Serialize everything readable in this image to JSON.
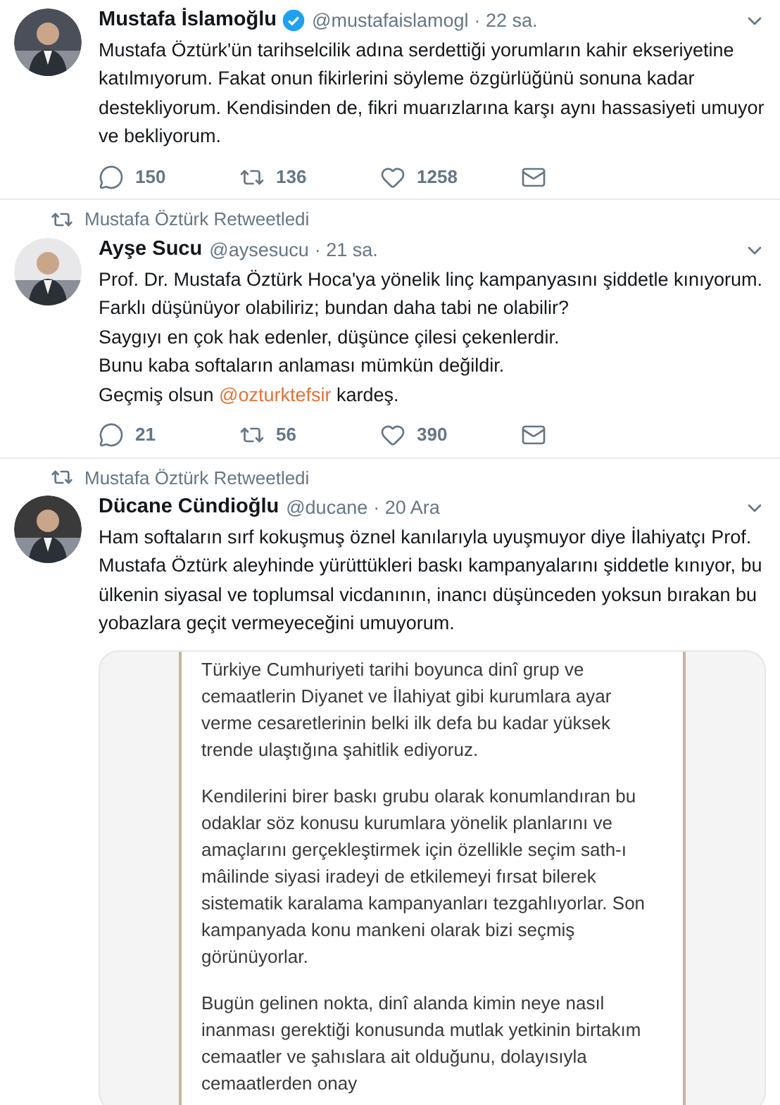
{
  "tweets": [
    {
      "name": "Mustafa İslamoğlu",
      "verified": true,
      "handle": "@mustafaislamogl",
      "time": "· 22 sa.",
      "body": [
        [
          {
            "text": "Mustafa Öztürk'ün tarihselcilik adına serdettiği yorumların kahir ekseriyetine katılmıyorum. Fakat onun fikirlerini söyleme özgürlüğünü sonuna kadar destekliyorum. Kendisinden de, fikri muarızlarına karşı aynı hassasiyeti umuyor ve bekliyorum.",
            "kind": "text"
          }
        ]
      ],
      "replies": "150",
      "retweets": "136",
      "likes": "1258"
    },
    {
      "retweeted_by": "Mustafa Öztürk Retweetledi",
      "name": "Ayşe Sucu",
      "verified": false,
      "handle": "@aysesucu",
      "time": "· 21 sa.",
      "body": [
        [
          {
            "text": "Prof. Dr. Mustafa Öztürk Hoca'ya yönelik linç kampanyasını şiddetle kınıyorum.",
            "kind": "text"
          }
        ],
        [
          {
            "text": "Farklı düşünüyor olabiliriz; bundan daha tabi ne olabilir?",
            "kind": "text"
          }
        ],
        [
          {
            "text": "Saygıyı en çok hak edenler, düşünce çilesi çekenlerdir.",
            "kind": "text"
          }
        ],
        [
          {
            "text": "Bunu kaba softaların anlaması mümkün değildir.",
            "kind": "text"
          }
        ],
        [
          {
            "text": "Geçmiş olsun ",
            "kind": "text"
          },
          {
            "text": "@ozturktefsir",
            "kind": "mention"
          },
          {
            "text": " kardeş.",
            "kind": "text"
          }
        ]
      ],
      "replies": "21",
      "retweets": "56",
      "likes": "390"
    },
    {
      "retweeted_by": "Mustafa Öztürk Retweetledi",
      "name": "Dücane Cündioğlu",
      "verified": false,
      "handle": "@ducane",
      "time": "· 20 Ara",
      "body": [
        [
          {
            "text": "Ham softaların sırf kokuşmuş öznel kanılarıyla uyuşmuyor diye İlahiyatçı Prof. Mustafa Öztürk aleyhinde yürüttükleri baskı kampanyalarını şiddetle kınıyor, bu ülkenin siyasal ve toplumsal vicdanının, inancı düşünceden yoksun bırakan bu yobazlara geçit vermeyeceğini umuyorum.",
            "kind": "text"
          }
        ]
      ],
      "document": [
        "Türkiye Cumhuriyeti tarihi boyunca dinî grup ve cemaatlerin Diyanet ve İlahiyat gibi kurumlara ayar verme cesaretlerinin belki ilk defa bu kadar yüksek trende ulaştığına şahitlik ediyoruz.",
        "Kendilerini birer baskı grubu olarak konumlandıran bu odaklar söz konusu kurumlara yönelik planlarını ve amaçlarını gerçekleştirmek için özellikle seçim sath-ı mâilinde siyasi iradeyi de etkilemeyi fırsat bilerek sistematik karalama kampanyanları tezgahlıyorlar. Son kampanyada konu mankeni olarak bizi seçmiş görünüyorlar.",
        "Bugün gelinen nokta, dinî alanda kimin neye nasıl inanması gerektiği konusunda mutlak yetkinin birtakım cemaatler ve şahıslara ait olduğunu, dolayısıyla cemaatlerden onay"
      ]
    }
  ]
}
